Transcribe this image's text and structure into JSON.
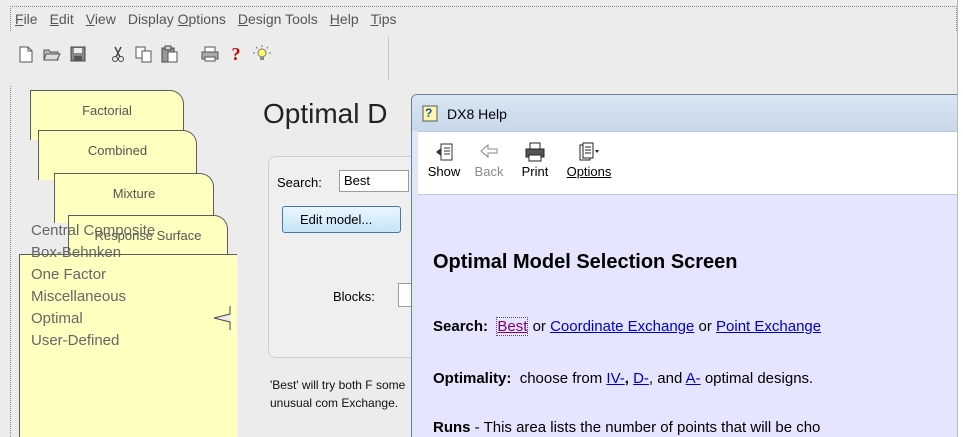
{
  "menu": [
    {
      "label": "File",
      "underline": "F",
      "rest": "ile"
    },
    {
      "label": "Edit",
      "underline": "E",
      "rest": "dit"
    },
    {
      "label": "View",
      "underline": "V",
      "rest": "iew"
    },
    {
      "label": "Display Options",
      "pre": "Display ",
      "underline": "O",
      "rest": "ptions"
    },
    {
      "label": "Design Tools",
      "underline": "D",
      "rest": "esign Tools"
    },
    {
      "label": "Help",
      "underline": "H",
      "rest": "elp"
    },
    {
      "label": "Tips",
      "underline": "T",
      "rest": "ips"
    }
  ],
  "toolbar_icons": [
    "new-document-icon",
    "open-folder-icon",
    "save-icon",
    "cut-icon",
    "copy-icon",
    "paste-icon",
    "print-icon",
    "help-question-icon",
    "tips-lightbulb-icon"
  ],
  "tabs": {
    "factorial": "Factorial",
    "combined": "Combined",
    "mixture": "Mixture",
    "response_surface": "Response Surface"
  },
  "designs": [
    "Central Composite",
    "Box-Behnken",
    "One Factor",
    "Miscellaneous",
    "Optimal",
    "User-Defined"
  ],
  "main": {
    "title": "Optimal D",
    "search_label": "Search:",
    "search_value": "Best",
    "edit_model": "Edit model...",
    "blocks_label": "Blocks:",
    "description": "'Best' will try both F some unusual com Exchange."
  },
  "help": {
    "window_title": "DX8 Help",
    "toolbar": {
      "show": "Show",
      "back": "Back",
      "print": "Print",
      "options": "Options"
    },
    "heading": "Optimal Model Selection Screen",
    "search_label": "Search:",
    "search_best": "Best",
    "or1": "or",
    "coord": "Coordinate Exchange",
    "or2": "or",
    "point": "Point Exchange",
    "optimality_label": "Optimality:",
    "optimality_text": "choose from",
    "iv": "IV-",
    "d": "D-",
    "and": ", and",
    "a": "A-",
    "optimal_designs": "optimal designs.",
    "runs_label": "Runs",
    "runs_text": "- This area lists the number of points that will be cho"
  },
  "colors": {
    "tab_fill": "#ffffc0",
    "help_content_bg": "#e5e5ff",
    "link": "#0000cc",
    "visited_link": "#800080"
  }
}
